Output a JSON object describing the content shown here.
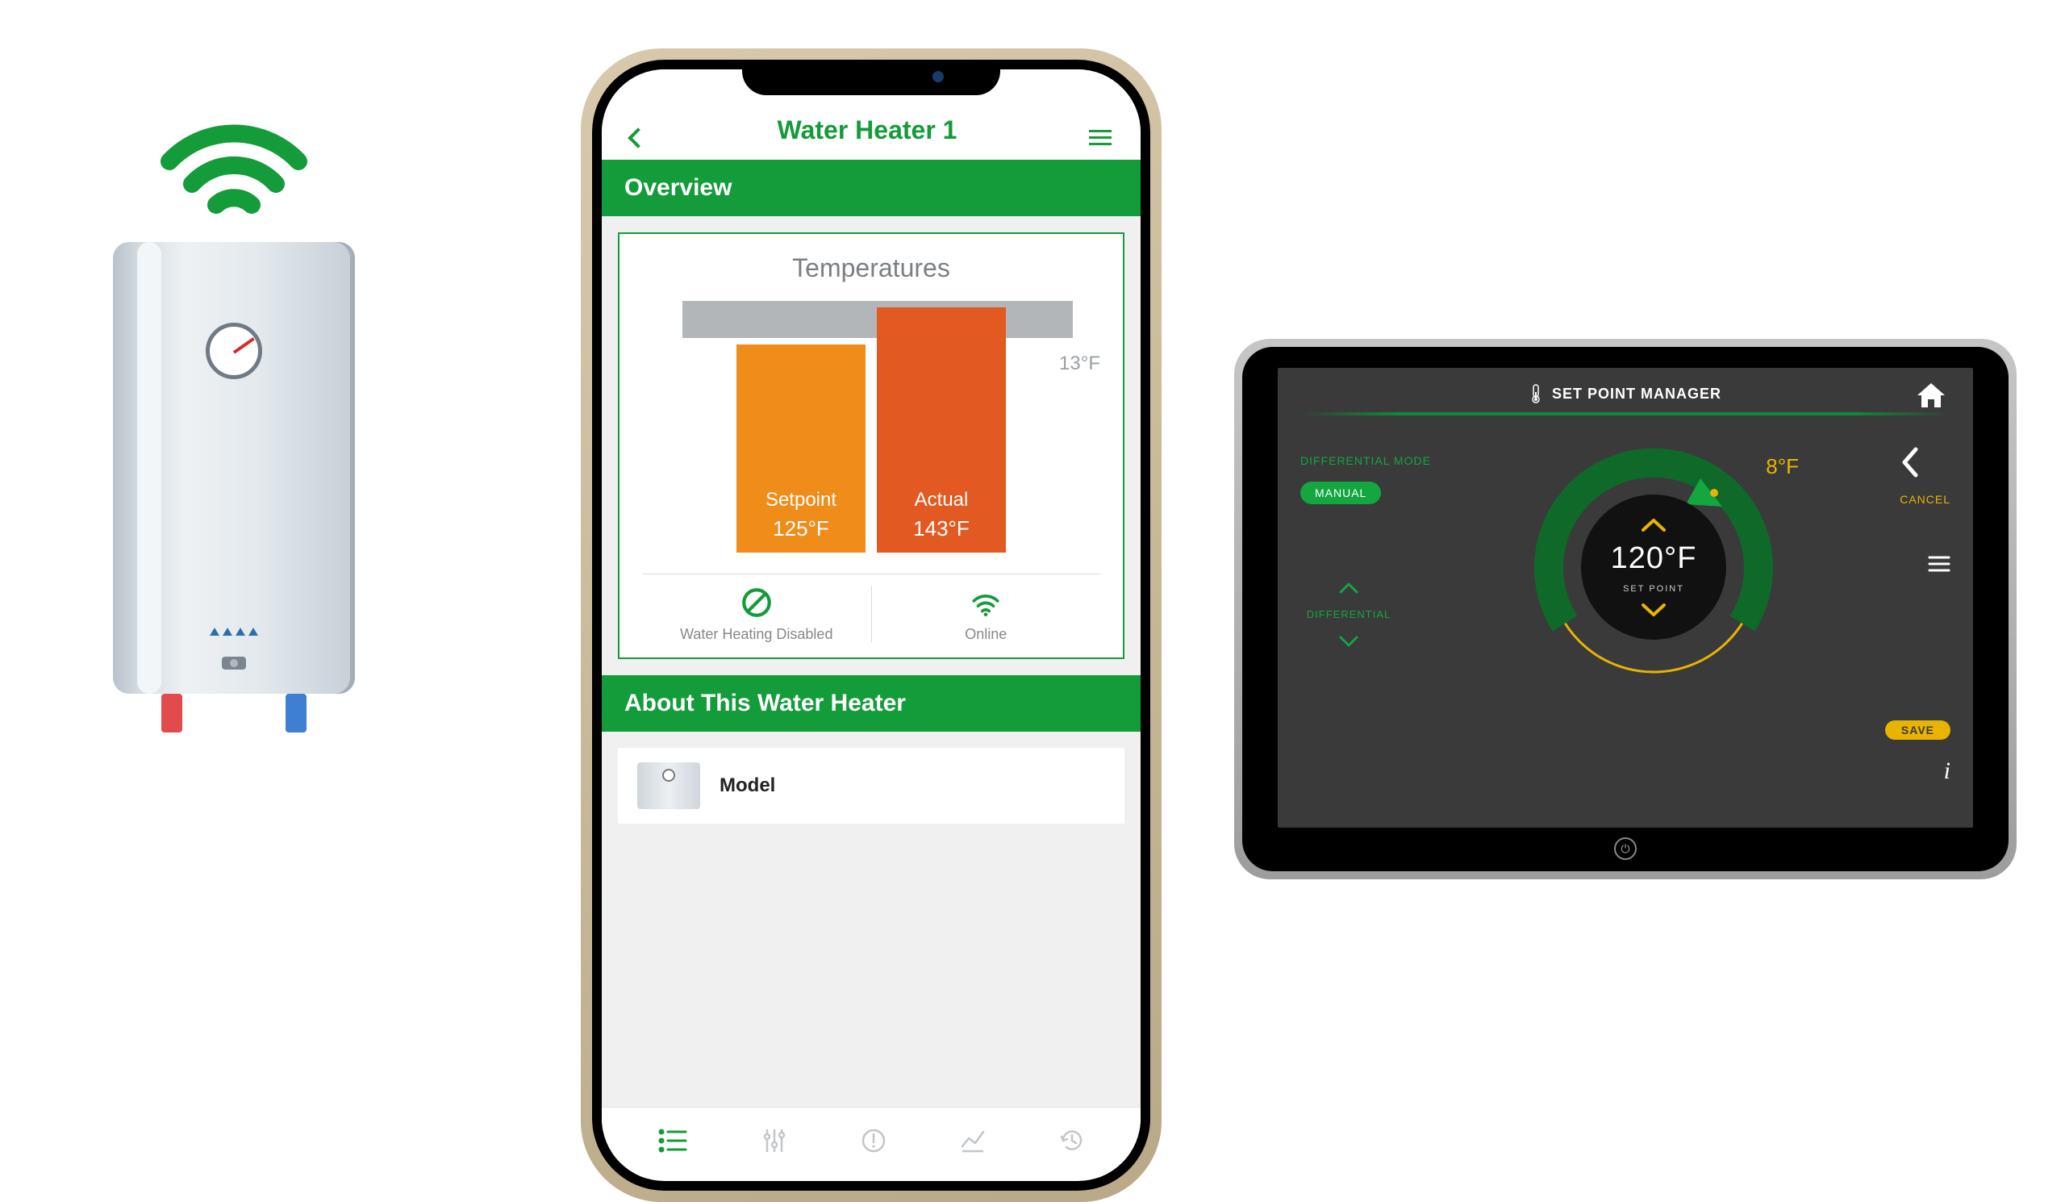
{
  "phone": {
    "header": {
      "title": "Water Heater 1"
    },
    "sections": {
      "overview": "Overview",
      "about": "About This Water Heater"
    },
    "temperatures": {
      "title": "Temperatures",
      "scale_label": "13°F",
      "setpoint": {
        "label": "Setpoint",
        "value": "125°F"
      },
      "actual": {
        "label": "Actual",
        "value": "143°F"
      }
    },
    "status": {
      "heating": "Water Heating Disabled",
      "online": "Online"
    },
    "about_card": {
      "model_label": "Model"
    }
  },
  "tablet": {
    "title": "SET POINT MANAGER",
    "differential_mode_label": "DIFFERENTIAL MODE",
    "mode_pill": "MANUAL",
    "differential_label": "DIFFERENTIAL",
    "dial": {
      "indicator_value": "8°F",
      "temperature": "120°F",
      "sub": "SET POINT"
    },
    "cancel": "CANCEL",
    "save": "SAVE"
  },
  "chart_data": {
    "type": "bar",
    "title": "Temperatures",
    "categories": [
      "Setpoint",
      "Actual"
    ],
    "values": [
      125,
      143
    ],
    "unit": "°F",
    "scale_delta_label": "13°F"
  }
}
